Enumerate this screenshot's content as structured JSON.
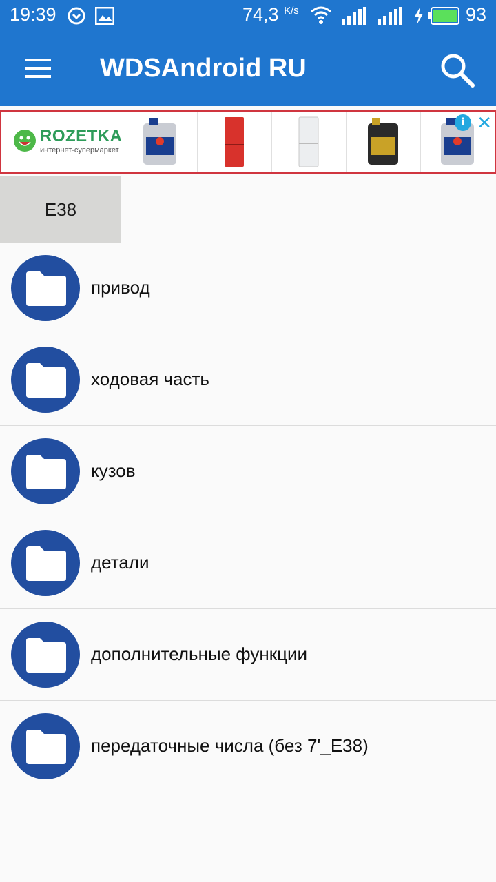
{
  "status_bar": {
    "time": "19:39",
    "network_speed": "74,3",
    "speed_unit": "K/s",
    "battery_percent": "93"
  },
  "app_bar": {
    "title": "WDSAndroid RU",
    "menu_icon": "hamburger-menu-icon",
    "search_icon": "search-icon"
  },
  "ad": {
    "brand": "ROZETKA",
    "brand_subtitle": "интернет-супермаркет",
    "info_label": "i",
    "close_label": "✕",
    "products": [
      "motor-oil",
      "red-fridge",
      "white-fridge",
      "motor-oil-black",
      "motor-oil"
    ]
  },
  "tab": {
    "label": "E38"
  },
  "folders": [
    {
      "label": "привод"
    },
    {
      "label": "ходовая часть"
    },
    {
      "label": "кузов"
    },
    {
      "label": "детали"
    },
    {
      "label": "дополнительные функции"
    },
    {
      "label": "передаточные числа (без 7'_E38)"
    }
  ],
  "colors": {
    "primary": "#1f76cf",
    "folder_circle": "#224ea0",
    "ad_border": "#d0353f"
  }
}
